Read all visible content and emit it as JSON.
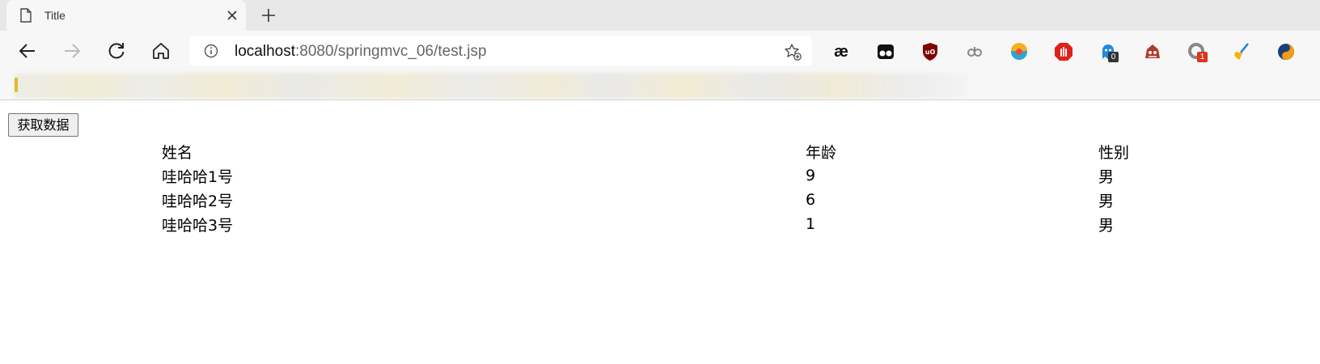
{
  "browser": {
    "tab_title": "Title",
    "url_host": "localhost",
    "url_rest": ":8080/springmvc_06/test.jsp",
    "extensions": [
      {
        "name": "ae-extension-icon",
        "label": "æ"
      },
      {
        "name": "tampermonkey-icon"
      },
      {
        "name": "ublock-origin-icon"
      },
      {
        "name": "link-extension-icon"
      },
      {
        "name": "colorful-extension-icon"
      },
      {
        "name": "adblock-stop-icon"
      },
      {
        "name": "ghostery-icon",
        "badge": "0"
      },
      {
        "name": "red-monster-icon"
      },
      {
        "name": "gray-loop-icon",
        "badge": "1"
      },
      {
        "name": "broom-icon"
      },
      {
        "name": "blue-orange-circle-icon"
      }
    ]
  },
  "page": {
    "button_label": "获取数据",
    "table": {
      "headers": [
        "姓名",
        "年龄",
        "性别"
      ],
      "rows": [
        [
          "哇哈哈1号",
          "9",
          "男"
        ],
        [
          "哇哈哈2号",
          "6",
          "男"
        ],
        [
          "哇哈哈3号",
          "1",
          "男"
        ]
      ]
    }
  }
}
